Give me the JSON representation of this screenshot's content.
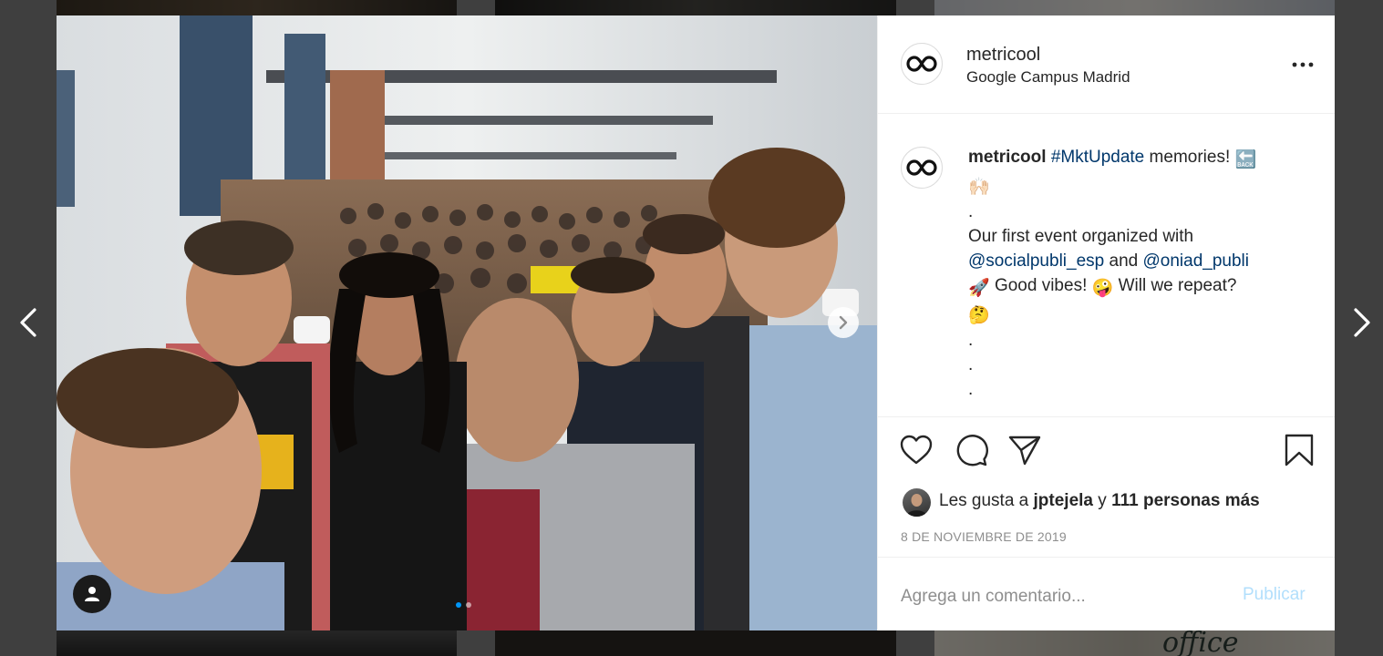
{
  "post": {
    "username": "metricool",
    "location": "Google Campus Madrid",
    "caption": {
      "hashtag": "#MktUpdate",
      "line1_rest": " memories! ",
      "back_emoji": "🔙",
      "raised_hands_emoji": "🙌🏻",
      "dot": ".",
      "line3": "Our first event organized with",
      "mention1": "@socialpubli_esp",
      "and_text": " and ",
      "mention2": "@oniad_publi",
      "rocket_emoji": "🚀",
      "good_vibes": " Good vibes! ",
      "zany_emoji": "🤪",
      "will_repeat": " Will we repeat?",
      "thinking_emoji": "🤔"
    },
    "likes": {
      "prefix": "Les gusta a ",
      "user": "jptejela",
      "mid": " y ",
      "count_text": "111 personas más"
    },
    "date": "8 DE NOVIEMBRE DE 2019",
    "comment_placeholder": "Agrega un comentario...",
    "publish_label": "Publicar"
  },
  "carousel": {
    "current_index": 1,
    "total": 2
  },
  "icons": {
    "prev": "chevron-left-icon",
    "next": "chevron-right-icon",
    "like": "heart-icon",
    "comment": "comment-bubble-icon",
    "share": "paper-plane-icon",
    "save": "bookmark-icon",
    "more": "more-dots-icon",
    "user_tag": "user-icon"
  },
  "colors": {
    "link": "#00376b",
    "publish_disabled": "#b2dffc",
    "carousel_active_dot": "#0095f6",
    "muted_text": "#8e8e8e"
  }
}
